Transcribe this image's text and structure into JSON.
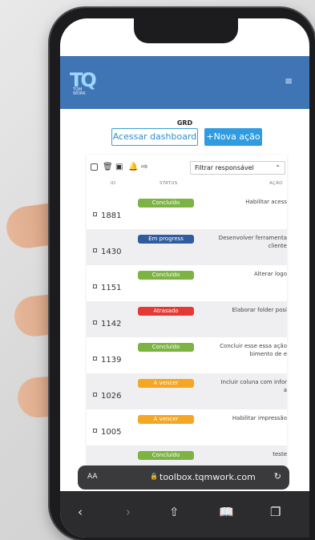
{
  "header": {
    "logo_mark": "TQ",
    "logo_sub": "TQM\nWORK",
    "menu_icon": "hamburger-icon"
  },
  "page": {
    "title": "GRD",
    "btn_dashboard": "Acessar dashboard",
    "btn_new": "+Nova ação"
  },
  "filter": {
    "placeholder": "Filtrar responsável"
  },
  "columns": {
    "id": "ID",
    "status": "STATUS",
    "acao": "AÇÃO"
  },
  "rows": [
    {
      "id": "1881",
      "status": "Concluído",
      "color": "#7cb342",
      "action": "Habilitar acess"
    },
    {
      "id": "1430",
      "status": "Em progress",
      "color": "#2f5c9e",
      "action": "Desenvolver ferramenta\ncliente"
    },
    {
      "id": "1151",
      "status": "Concluído",
      "color": "#7cb342",
      "action": "Alterar logo"
    },
    {
      "id": "1142",
      "status": "Atrasado",
      "color": "#e53935",
      "action": "Elaborar folder posi"
    },
    {
      "id": "1139",
      "status": "Concluído",
      "color": "#7cb342",
      "action": "Concluir esse essa ação\nbimento de e"
    },
    {
      "id": "1026",
      "status": "A vencer",
      "color": "#f5a623",
      "action": "Incluir coluna com infor\na"
    },
    {
      "id": "1005",
      "status": "A vencer",
      "color": "#f5a623",
      "action": "Habilitar impressão"
    },
    {
      "id": "",
      "status": "Concluído",
      "color": "#7cb342",
      "action": "teste"
    }
  ],
  "browser": {
    "aa": "AA",
    "url": "toolbox.tqmwork.com"
  }
}
